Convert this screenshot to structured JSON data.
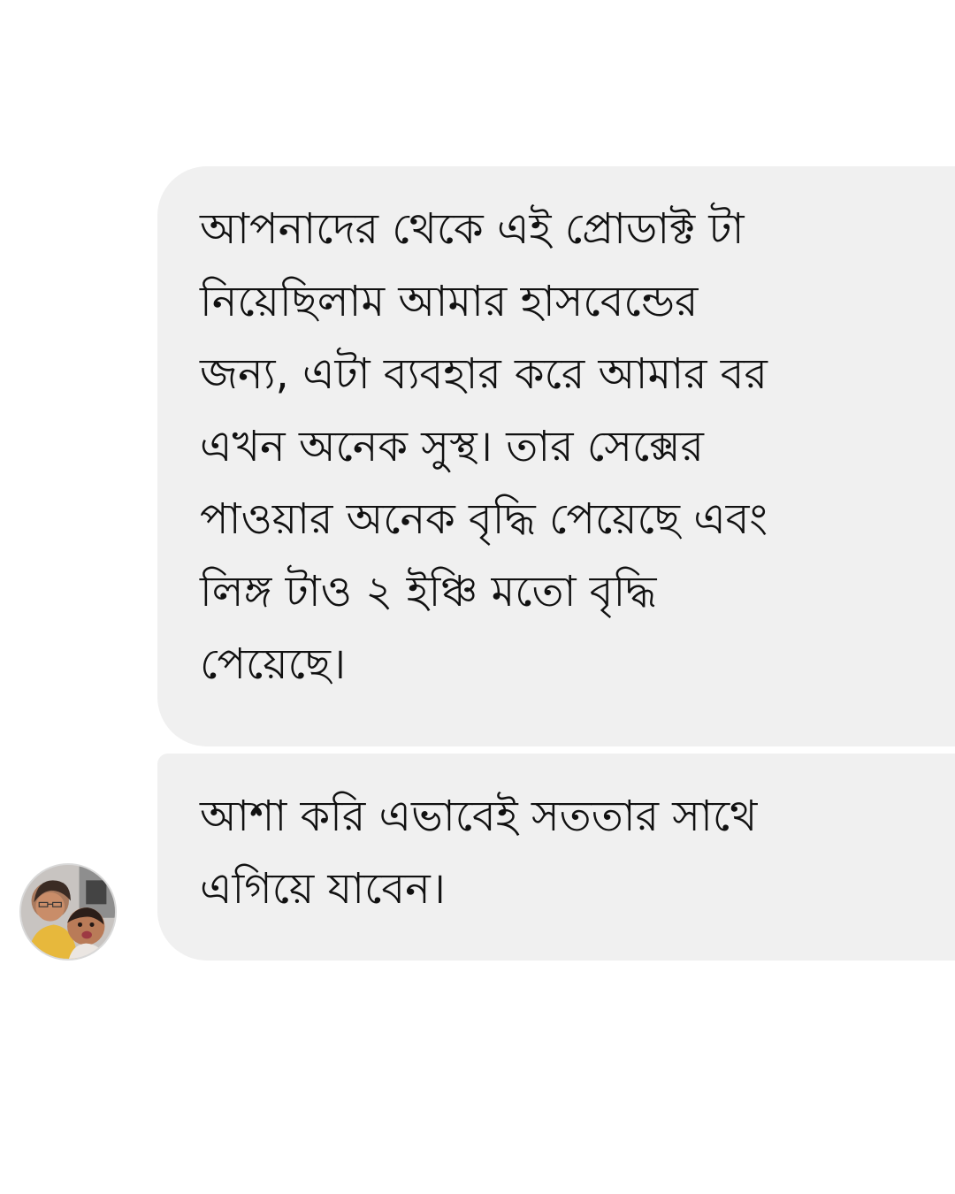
{
  "messages": [
    {
      "text": "আপনাদের থেকে এই প্রোডাক্ট টা\nনিয়েছিলাম আমার হাসবেন্ডের\nজন্য, এটা ব্যবহার করে আমার বর\nএখন অনেক সুস্থ। তার সেক্সের\nপাওয়ার অনেক বৃদ্ধি পেয়েছে এবং\nলিঙ্গ টাও ২ ইঞ্চি মতো বৃদ্ধি\nপেয়েছে।"
    },
    {
      "text": "আশা করি এভাবেই সততার সাথে\nএগিয়ে যাবেন।"
    }
  ],
  "sender": {
    "avatar_icon": "user-photo-avatar"
  },
  "colors": {
    "background": "#ffffff",
    "bubble": "#f0f0f0",
    "text": "#111111"
  }
}
